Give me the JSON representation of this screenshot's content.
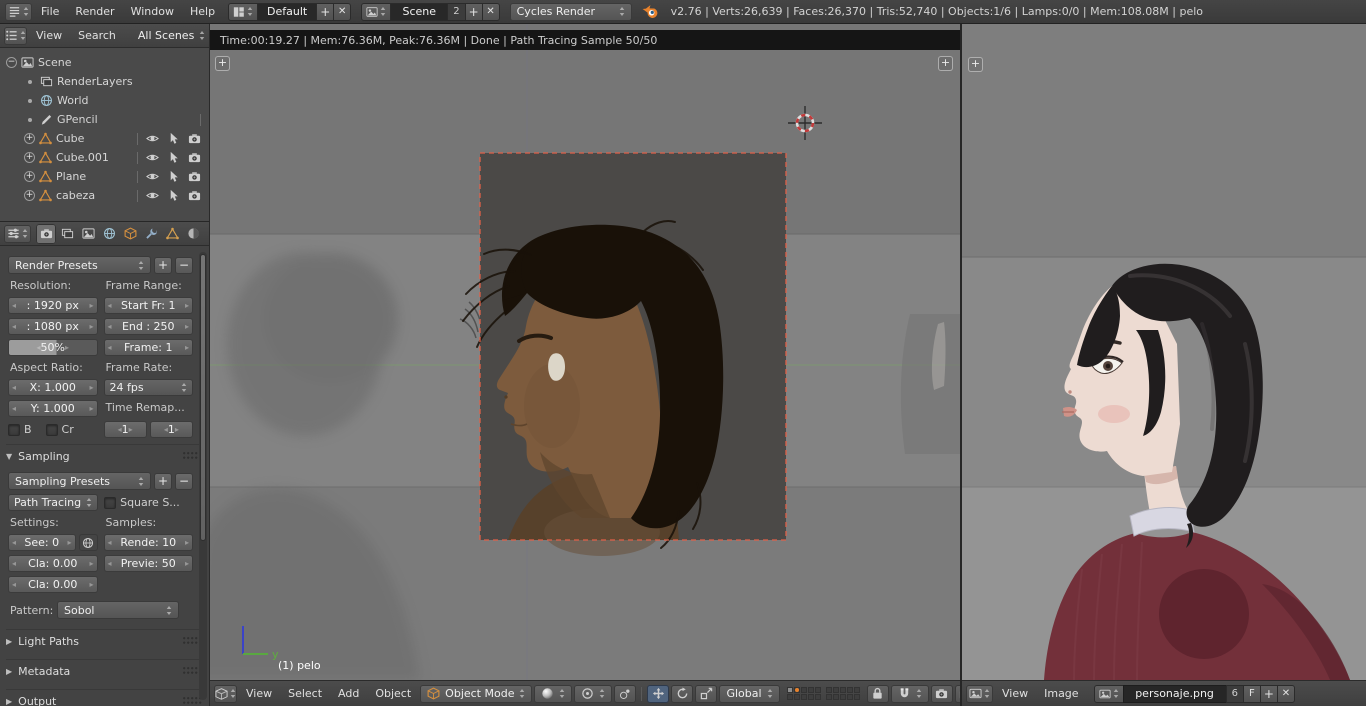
{
  "glyphs": {
    "plus": "+",
    "minus": "−",
    "close": "✕"
  },
  "info_bar": {
    "menus": [
      "File",
      "Render",
      "Window",
      "Help"
    ],
    "layout_value": "Default",
    "scene_value": "Scene",
    "scene_users": "2",
    "engine_value": "Cycles Render",
    "stats": "v2.76 | Verts:26,639 | Faces:26,370 | Tris:52,740 | Objects:1/6 | Lamps:0/0 | Mem:108.08M | pelo"
  },
  "render_status": "Time:00:19.27 | Mem:76.36M, Peak:76.36M | Done | Path Tracing Sample 50/50",
  "outliner": {
    "menus": {
      "view": "View",
      "search": "Search"
    },
    "scope": "All Scenes",
    "items": [
      {
        "label": "Scene"
      },
      {
        "label": "RenderLayers"
      },
      {
        "label": "World"
      },
      {
        "label": "GPencil"
      },
      {
        "label": "Cube"
      },
      {
        "label": "Cube.001"
      },
      {
        "label": "Plane"
      },
      {
        "label": "cabeza"
      }
    ]
  },
  "properties": {
    "dimensions": {
      "presets": "Render Presets",
      "resolution_label": "Resolution:",
      "frame_range_label": "Frame Range:",
      "res_x": ": 1920 px",
      "res_y": ": 1080 px",
      "res_percent": "50%",
      "frame_start": "Start Fr: 1",
      "frame_end": "End : 250",
      "frame_current": "Frame: 1",
      "aspect_label": "Aspect Ratio:",
      "frame_rate_label": "Frame Rate:",
      "aspect_x": "X: 1.000",
      "aspect_y": "Y: 1.000",
      "fps": "24 fps",
      "time_remap": "Time Remap...",
      "border_label": "B",
      "crop_label": "Cr",
      "remap_old": "1",
      "remap_new": "1"
    },
    "sampling": {
      "title": "Sampling",
      "presets": "Sampling Presets",
      "integrator": "Path Tracing",
      "square_samples": "Square S...",
      "settings_label": "Settings:",
      "samples_label": "Samples:",
      "seed": "See: 0",
      "clamp_direct": "Cla: 0.00",
      "clamp_indirect": "Cla: 0.00",
      "samples_render": "Rende: 10",
      "samples_preview": "Previe: 50",
      "pattern_label": "Pattern:",
      "pattern_value": "Sobol"
    },
    "collapsed_panels": [
      "Light Paths",
      "Metadata",
      "Output"
    ]
  },
  "viewport": {
    "status_overlay": "(1) pelo",
    "header": {
      "menus": [
        "View",
        "Select",
        "Add",
        "Object"
      ],
      "mode": "Object Mode",
      "orientation": "Global"
    }
  },
  "image_editor": {
    "header": {
      "menus": [
        "View",
        "Image"
      ],
      "image_name": "personaje.png",
      "users": "6",
      "fake_user": "F"
    }
  }
}
